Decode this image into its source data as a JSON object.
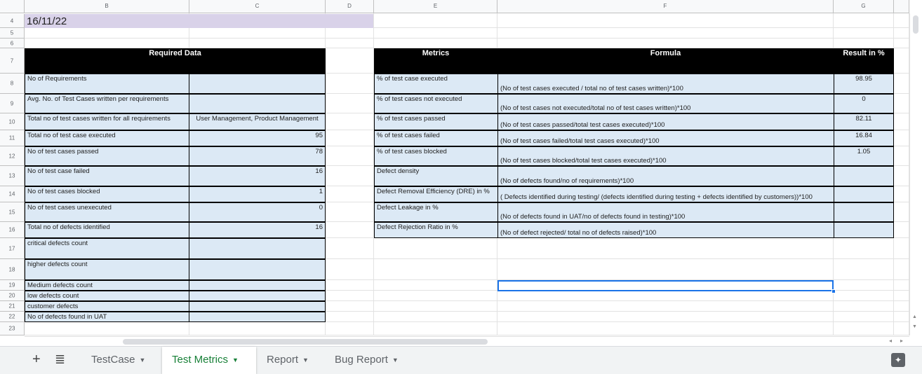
{
  "columns": [
    "B",
    "C",
    "D",
    "E",
    "F",
    "G"
  ],
  "rows": [
    "4",
    "5",
    "6",
    "7",
    "8",
    "9",
    "10",
    "11",
    "12",
    "13",
    "14",
    "15",
    "16",
    "17",
    "18",
    "19",
    "20",
    "21",
    "22",
    "23"
  ],
  "date": "16/11/22",
  "required_data": {
    "header": "Required Data",
    "items": [
      {
        "label": "No of Requirements",
        "value": ""
      },
      {
        "label": "Avg. No. of Test Cases written per requirements",
        "value": ""
      },
      {
        "label": "Total no of test cases written for all requirements",
        "value": "User Management, Product Management"
      },
      {
        "label": "Total no of test case executed",
        "value": "95"
      },
      {
        "label": "No of test cases passed",
        "value": "78"
      },
      {
        "label": "No of test case failed",
        "value": "16"
      },
      {
        "label": "No of test cases blocked",
        "value": "1"
      },
      {
        "label": "No of test cases unexecuted",
        "value": "0"
      },
      {
        "label": "Total no of defects identified",
        "value": "16"
      },
      {
        "label": "critical defects count",
        "value": ""
      },
      {
        "label": "higher defects count",
        "value": ""
      },
      {
        "label": "Medium defects count",
        "value": ""
      },
      {
        "label": "low defects count",
        "value": ""
      },
      {
        "label": "customer defects",
        "value": ""
      },
      {
        "label": "No of defects found in UAT",
        "value": ""
      }
    ]
  },
  "metrics": {
    "headers": {
      "metric": "Metrics",
      "formula": "Formula",
      "result": "Result in %"
    },
    "items": [
      {
        "metric": "% of test case executed",
        "formula": "(No of test cases executed / total no of test cases written)*100",
        "result": "98.95"
      },
      {
        "metric": "% of test cases not executed",
        "formula": "(No of test cases not executed/total no of test cases written)*100",
        "result": "0"
      },
      {
        "metric": "% of test cases passed",
        "formula": "(No of test cases passed/total test cases executed)*100",
        "result": "82.11"
      },
      {
        "metric": "% of test cases failed",
        "formula": "(No of test cases failed/total test cases executed)*100",
        "result": "16.84"
      },
      {
        "metric": "% of test cases blocked",
        "formula": "(No of test cases blocked/total test cases executed)*100",
        "result": "1.05"
      },
      {
        "metric": "Defect density",
        "formula": "(No of defects found/no of requirements)*100",
        "result": ""
      },
      {
        "metric": "Defect Removal Efficiency (DRE) in %",
        "formula": "( Defects identified during testing/ (defects identified during testing + defects identified by customers))*100",
        "result": ""
      },
      {
        "metric": "Defect Leakage in %",
        "formula": "(No of defects found in UAT/no of defects found in testing)*100",
        "result": ""
      },
      {
        "metric": "Defect Rejection Ratio in %",
        "formula": "(No of defect rejected/ total no of defects raised)*100",
        "result": ""
      }
    ]
  },
  "sheet_tabs": [
    {
      "label": "TestCase",
      "active": false
    },
    {
      "label": "Test Metrics",
      "active": true
    },
    {
      "label": "Report",
      "active": false
    },
    {
      "label": "Bug Report",
      "active": false
    }
  ],
  "icons": {
    "add": "plus-icon",
    "all_sheets": "menu-icon",
    "explore": "explore-icon"
  },
  "colors": {
    "data_fill": "#dce9f5",
    "header_fill": "#000000",
    "date_fill": "#d9d2e9",
    "active_tab": "#188038",
    "selection": "#1a73e8"
  }
}
